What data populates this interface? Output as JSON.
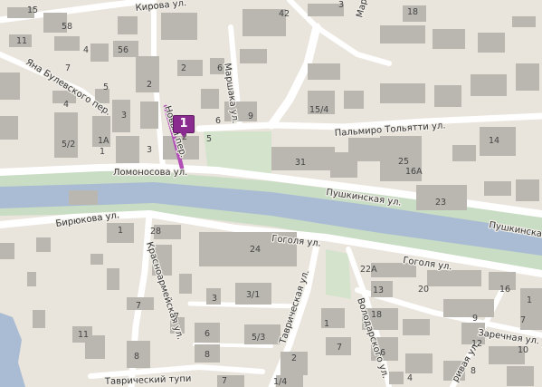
{
  "colors": {
    "background": "#e9e5dc",
    "building": "#bab7b1",
    "road": "#ffffff",
    "river": "#a9bcd4",
    "riverbank": "#c9dcc4",
    "park": "#d3e3cc",
    "water": "#a9bcd4",
    "route": "#b14fb6",
    "marker": "#8a2c8f"
  },
  "marker": {
    "label": "1"
  },
  "streets": {
    "kirova": "Кирова ул.",
    "marshaka_top": "Марша",
    "bulevskogo": "Яна Булевского пер.",
    "marshaka": "Маршака ул.",
    "palmiro": "Пальмиро Тольятти ул.",
    "novy": "Новый пер.",
    "lomonosova": "Ломоносова ул.",
    "pushkinskaya": "Пушкинская ул.",
    "pushkinskaya_right": "Пушкинская",
    "biryukova": "Бирюкова ул.",
    "gogolya": "Гоголя ул.",
    "gogolya_right": "Гоголя ул.",
    "krasnoarmeyskaya": "Красноармейская ул.",
    "tavricheskaya": "Таврическая ул.",
    "volodarskogo": "Володарского ул.",
    "zarechnaya": "Заречная ул.",
    "tavrichesky_tup": "Таврический тупи",
    "right_bottom": "ривая ул."
  },
  "house_numbers": {
    "h15": "15",
    "h58": "58",
    "h42": "42",
    "h3a": "3",
    "h18": "18",
    "h56": "56",
    "h11a": "11",
    "h4a": "4",
    "h7a": "7",
    "h2a": "2",
    "h6a": "6",
    "h5a": "5",
    "h3b": "3",
    "h2b": "2",
    "h6b": "6",
    "h9": "9",
    "h15_4": "15/4",
    "h4b": "4",
    "h1a": "1А",
    "h5_2": "5/2",
    "h1": "1",
    "h3c": "3",
    "h2c": "2",
    "h5b": "5",
    "h14": "14",
    "h31": "31",
    "h25": "25",
    "h16a": "16А",
    "h23": "23",
    "h28": "28",
    "h24": "24",
    "h1b": "1",
    "h3d": "3",
    "h3_1": "3/1",
    "h7b": "7",
    "h7c": "7",
    "h6c": "6",
    "h8a": "8",
    "h5_3": "5/3",
    "h11b": "11",
    "h8b": "8",
    "h7d": "7",
    "h22a": "22А",
    "h13": "13",
    "h20": "20",
    "h18b": "18",
    "h2d": "2",
    "h6d": "6",
    "h4c": "4",
    "h9b": "9",
    "h16": "16",
    "h1c": "1",
    "h7e": "7",
    "h12": "12",
    "h10": "10",
    "h1_4": "1/4",
    "h7f": "7",
    "h8c": "8",
    "h1d": "1"
  }
}
